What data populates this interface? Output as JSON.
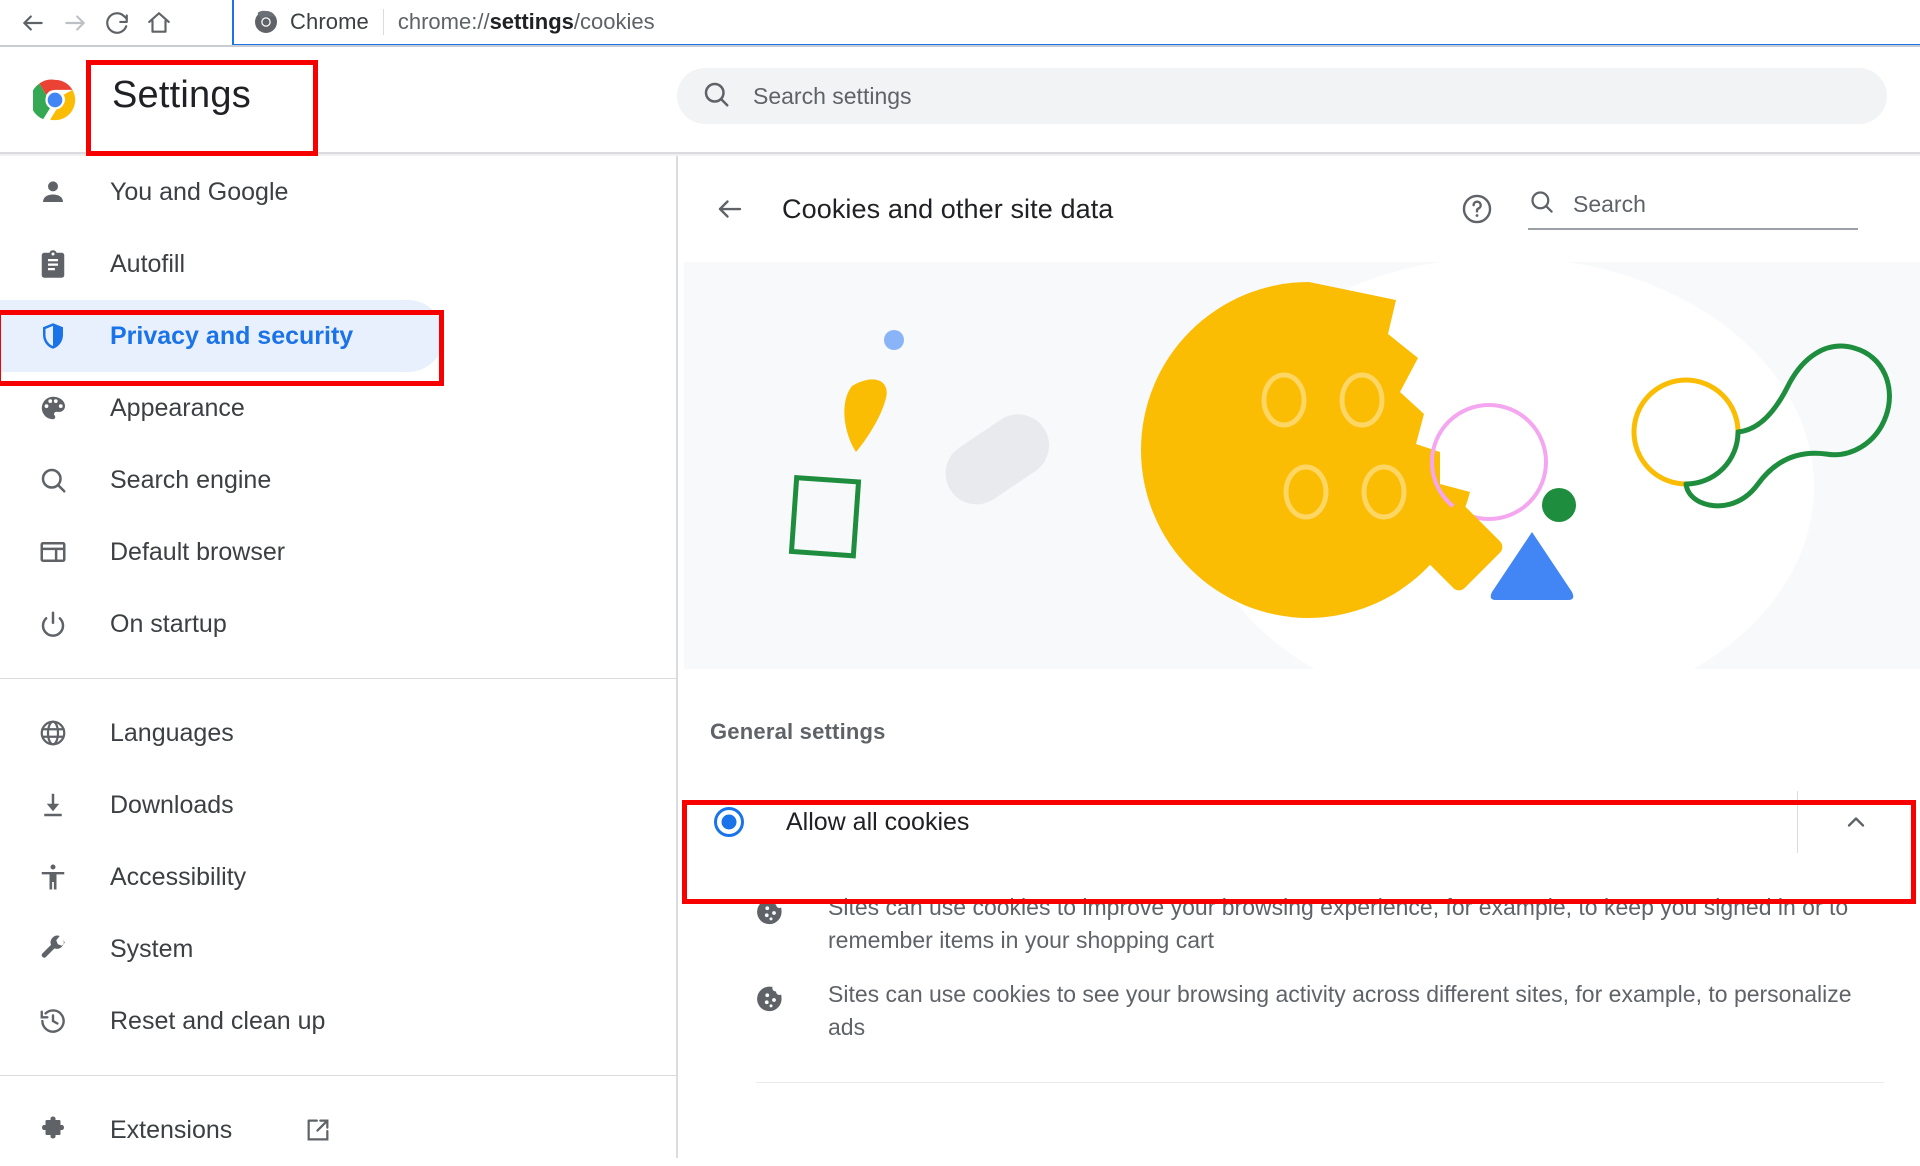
{
  "browser": {
    "back_icon": "arrow-back-icon",
    "forward_icon": "arrow-forward-icon",
    "reload_icon": "reload-icon",
    "home_icon": "home-icon",
    "scheme_label": "Chrome",
    "url_prefix": "chrome://",
    "url_bold": "settings",
    "url_suffix": "/cookies",
    "url_full": "chrome://settings/cookies",
    "accent_color": "#1a73e8"
  },
  "topbar": {
    "title": "Settings",
    "logo": "chrome-logo",
    "search": {
      "placeholder": "Search settings",
      "value": "",
      "icon": "search-icon"
    }
  },
  "sidebar": {
    "items": [
      {
        "label": "You and Google",
        "icon": "person-icon",
        "selected": false
      },
      {
        "label": "Autofill",
        "icon": "clipboard-icon",
        "selected": false
      },
      {
        "label": "Privacy and security",
        "icon": "shield-icon",
        "selected": true
      },
      {
        "label": "Appearance",
        "icon": "palette-icon",
        "selected": false
      },
      {
        "label": "Search engine",
        "icon": "search-icon",
        "selected": false
      },
      {
        "label": "Default browser",
        "icon": "browser-icon",
        "selected": false
      },
      {
        "label": "On startup",
        "icon": "power-icon",
        "selected": false
      }
    ],
    "items_group2": [
      {
        "label": "Languages",
        "icon": "globe-icon",
        "selected": false
      },
      {
        "label": "Downloads",
        "icon": "download-icon",
        "selected": false
      },
      {
        "label": "Accessibility",
        "icon": "accessibility-icon",
        "selected": false
      },
      {
        "label": "System",
        "icon": "wrench-icon",
        "selected": false
      },
      {
        "label": "Reset and clean up",
        "icon": "history-icon",
        "selected": false
      }
    ],
    "items_group3": [
      {
        "label": "Extensions",
        "icon": "puzzle-icon",
        "external_icon": "open-in-new-icon",
        "selected": false
      }
    ],
    "selected_color": "#1a73e8",
    "selected_background": "#e8f0fe"
  },
  "content": {
    "back_icon": "arrow-back-icon",
    "title": "Cookies and other site data",
    "help_icon": "help-circle-icon",
    "search": {
      "placeholder": "Search",
      "value": "",
      "icon": "search-icon"
    },
    "banner": {
      "name": "cookie-illustration",
      "background": "#f8f9fa",
      "cookie_color": "#fbbc04",
      "shapes": [
        "blue-dot",
        "yellow-wedge",
        "green-square-outline",
        "gray-pill",
        "big-cookie",
        "pink-circle-outline",
        "yellow-diamond",
        "blue-triangle",
        "green-dot",
        "peanut-outline"
      ]
    },
    "general_settings_label": "General settings",
    "option": {
      "label": "Allow all cookies",
      "selected": true,
      "radio_color": "#1a73e8",
      "expand_icon": "chevron-up-icon",
      "expanded": true
    },
    "descriptions": [
      {
        "icon": "cookie-icon",
        "text": "Sites can use cookies to improve your browsing experience, for example, to keep you signed in or to remember items in your shopping cart"
      },
      {
        "icon": "cookie-icon",
        "text": "Sites can use cookies to see your browsing activity across different sites, for example, to personalize ads"
      }
    ]
  },
  "annotations": {
    "highlight_color": "#f60000",
    "boxes": [
      {
        "name": "settings-title-highlight"
      },
      {
        "name": "privacy-and-security-highlight"
      },
      {
        "name": "allow-all-cookies-highlight"
      }
    ]
  }
}
